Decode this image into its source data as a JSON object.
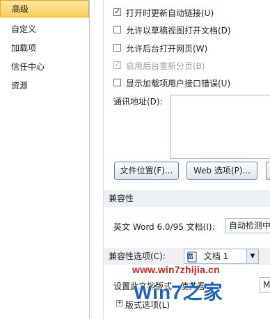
{
  "nav": {
    "items": [
      "高级",
      "自定义",
      "加载项",
      "信任中心",
      "资源"
    ],
    "active_index": 0
  },
  "general": {
    "checkboxes": [
      {
        "label": "打开时更新自动链接(U)",
        "checked": true,
        "disabled": false
      },
      {
        "label": "允许以草稿视图打开文档(D)",
        "checked": false,
        "disabled": false
      },
      {
        "label": "允许后台打开网页(W)",
        "checked": false,
        "disabled": false
      },
      {
        "label": "启用后台重新分页(B)",
        "checked": true,
        "disabled": true
      },
      {
        "label": "显示加载项用户接口错误(U)",
        "checked": false,
        "disabled": false
      }
    ],
    "mailing_address_label": "通讯地址(D):",
    "mailing_address_value": "",
    "file_locations_button": "文件位置(F)...",
    "web_options_button": "Web 选项(P)..."
  },
  "compatibility": {
    "section_title": "兼容性",
    "word_format_label": "英文 Word 6.0/95 文档(I):",
    "word_format_value": "自动检测中",
    "options_section_title": "兼容性选项(C):",
    "document_select_value": "文档 1",
    "layout_label": "设置此文档版式",
    "layout_label_tail": "使其看",
    "layout_select_value": "M",
    "layout_options_label": "版式选项(L)"
  },
  "watermark": {
    "url": "www.win7zhijia.cn",
    "logo": "Win7之家"
  },
  "colors": {
    "active_nav": "#fbcd5b",
    "section_bg": "#eef0f4",
    "border": "#a4b5cf",
    "watermark_red": "#d8241c",
    "watermark_blue": "#1e63b8"
  }
}
